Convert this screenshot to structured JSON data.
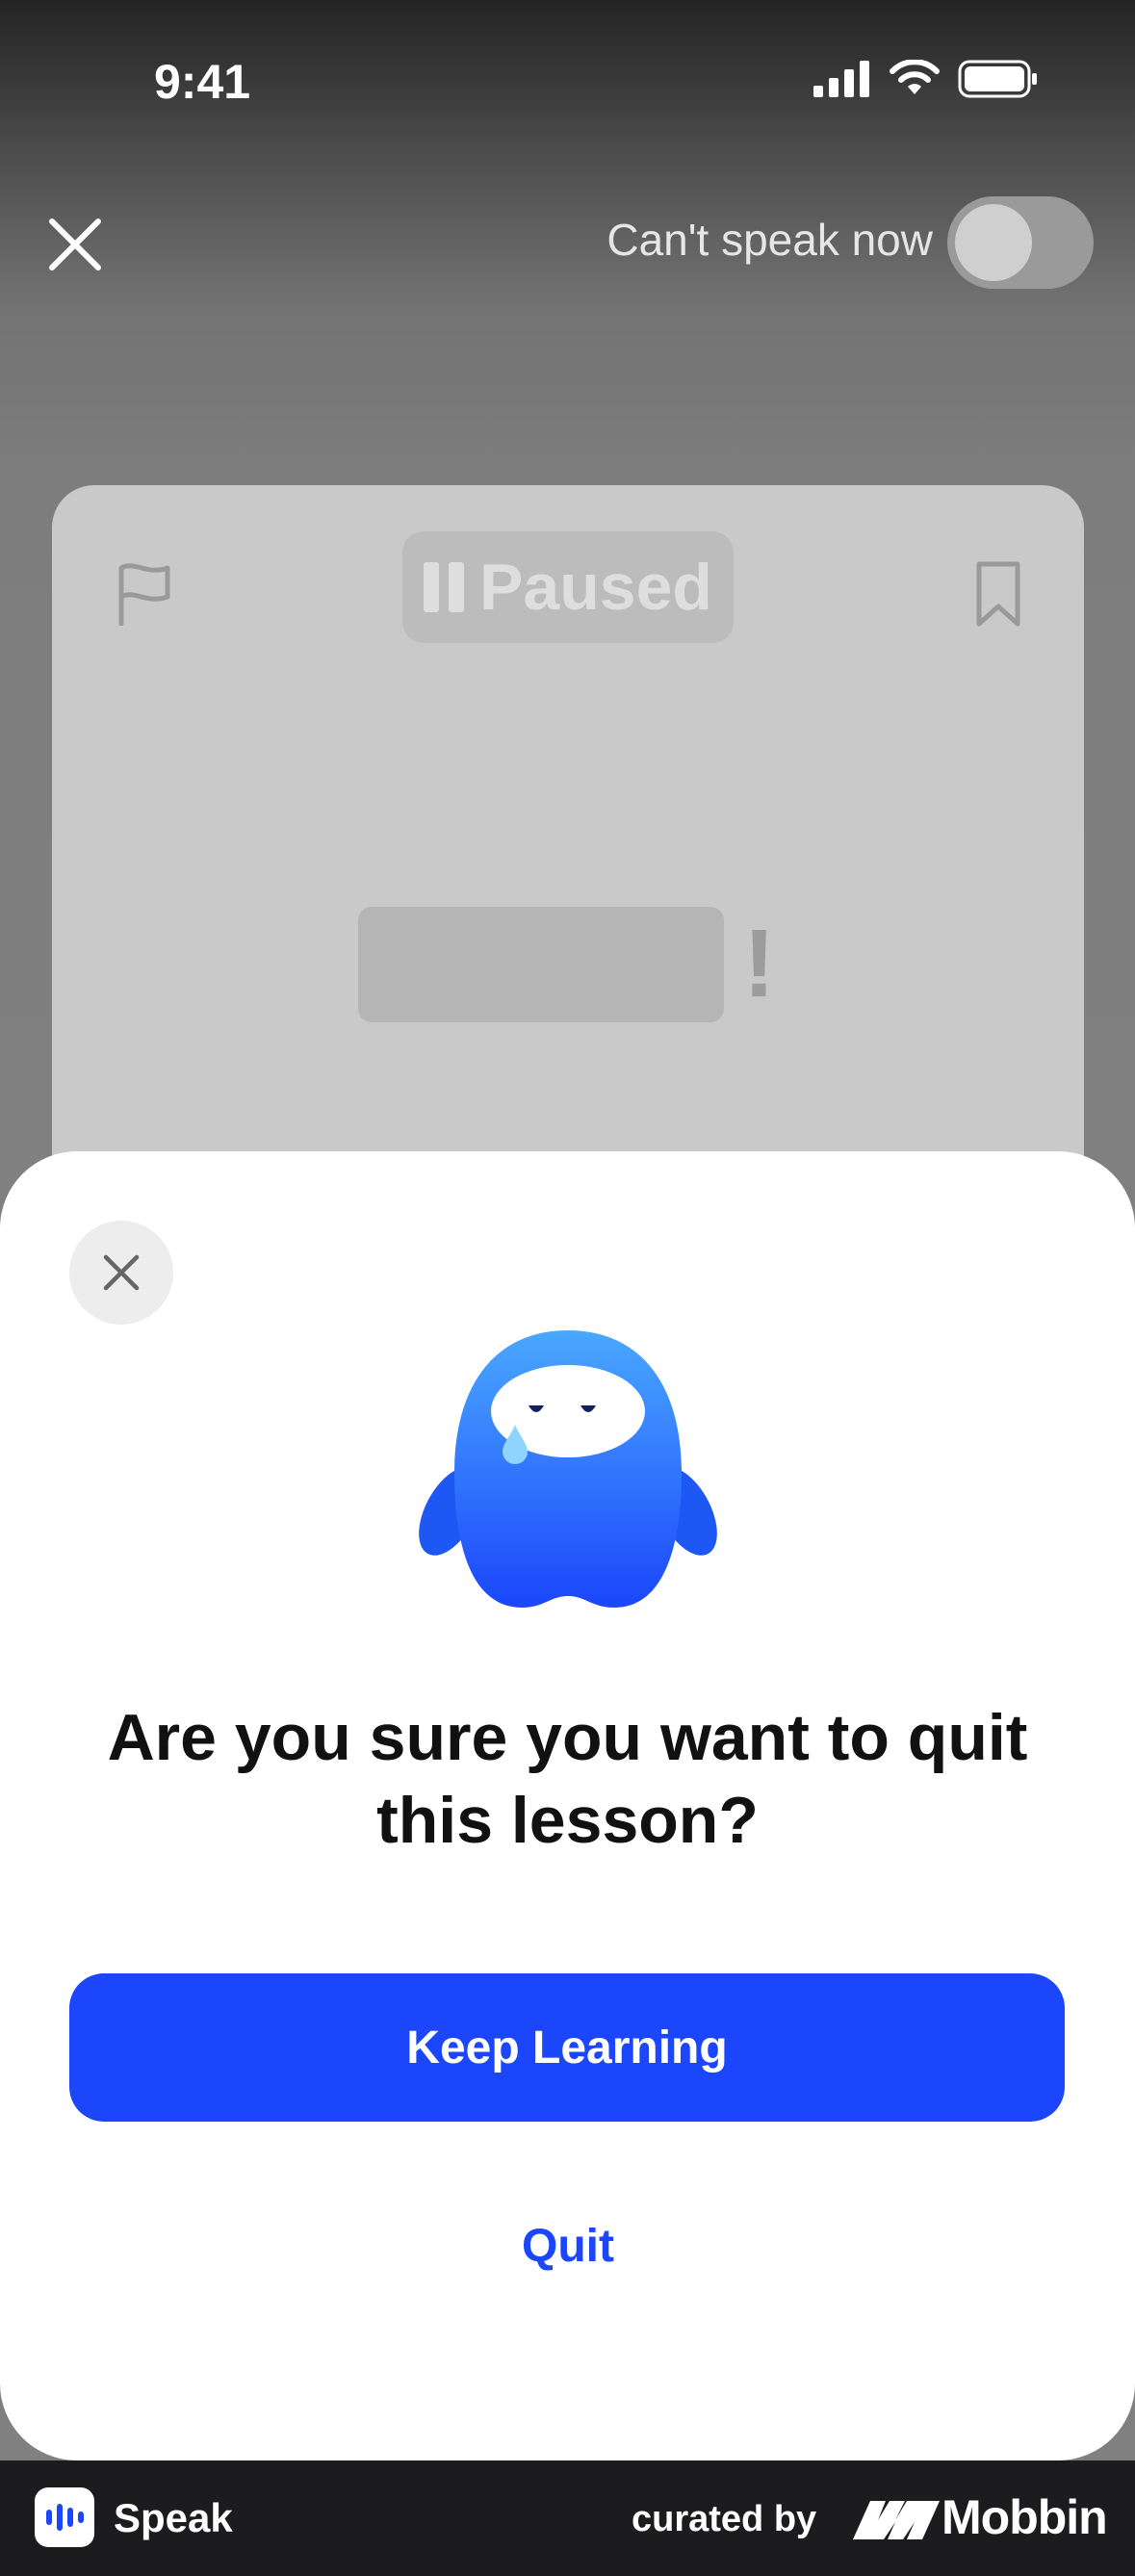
{
  "status_bar": {
    "time": "9:41"
  },
  "top_bar": {
    "cant_speak_label": "Can't speak now",
    "toggle_on": false
  },
  "lesson_card": {
    "paused_label": "Paused",
    "punctuation": "!"
  },
  "dialog": {
    "title": "Are you sure you want to quit this lesson?",
    "primary_button": "Keep Learning",
    "secondary_link": "Quit"
  },
  "footer": {
    "app_name": "Speak",
    "curated_by": "curated by",
    "brand": "Mobbin"
  },
  "colors": {
    "accent": "#1b46fb",
    "sheet_background": "#ffffff",
    "dim_background": "#808080"
  },
  "icons": {
    "top_close": "close-icon",
    "flag": "flag-icon",
    "bookmark": "bookmark-icon",
    "sheet_close": "close-icon",
    "signal": "cellular-signal-icon",
    "wifi": "wifi-icon",
    "battery": "battery-icon"
  }
}
